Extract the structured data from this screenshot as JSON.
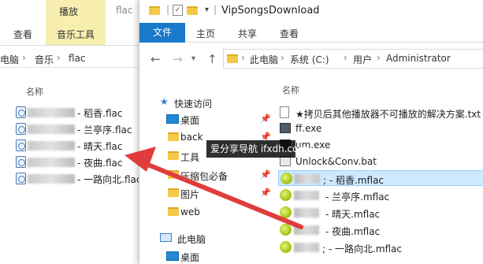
{
  "left_window": {
    "context_tab": "播放",
    "title": "flac",
    "ribbon_tabs": [
      "查看",
      "音乐工具"
    ],
    "breadcrumb": [
      "电脑",
      "音乐",
      "flac"
    ],
    "column_header": "名称",
    "files": [
      "- 稻香.flac",
      "- 兰亭序.flac",
      "- 晴天.flac",
      "- 夜曲.flac",
      "- 一路向北.flac"
    ]
  },
  "right_window": {
    "title": "VipSongsDownload",
    "ribbon_tabs": [
      "文件",
      "主页",
      "共享",
      "查看"
    ],
    "address": [
      "此电脑",
      "系统 (C:)",
      "用户",
      "Administrator"
    ],
    "nav_pane": {
      "quick_access": "快速访问",
      "items": [
        "桌面",
        "back",
        "工具",
        "压缩包必备",
        "图片",
        "web"
      ],
      "this_pc": "此电脑",
      "pc_items": [
        "桌面"
      ]
    },
    "column_header": "名称",
    "files": [
      {
        "name": "★拷贝后其他播放器不可播放的解决方案.txt",
        "icon": "text-file-icon"
      },
      {
        "name": "ff.exe",
        "icon": "exe-file-icon"
      },
      {
        "name": "um.exe",
        "icon": "exe-file-icon"
      },
      {
        "name": "Unlock&Conv.bat",
        "icon": "bat-file-icon"
      },
      {
        "name": "; - 稻香.mflac",
        "icon": "mflac-file-icon",
        "selected": true
      },
      {
        "name": "- 兰亭序.mflac",
        "icon": "mflac-file-icon"
      },
      {
        "name": "- 晴天.mflac",
        "icon": "mflac-file-icon"
      },
      {
        "name": "- 夜曲.mflac",
        "icon": "mflac-file-icon"
      },
      {
        "name": "; - 一路向北.mflac",
        "icon": "mflac-file-icon"
      }
    ]
  },
  "watermark": "爱分享导航 ifxdh.com",
  "colors": {
    "accent": "#1979ca",
    "context_tab_bg": "#f7eeb0",
    "selection": "#cde8ff",
    "arrow": "#e03c3c"
  }
}
